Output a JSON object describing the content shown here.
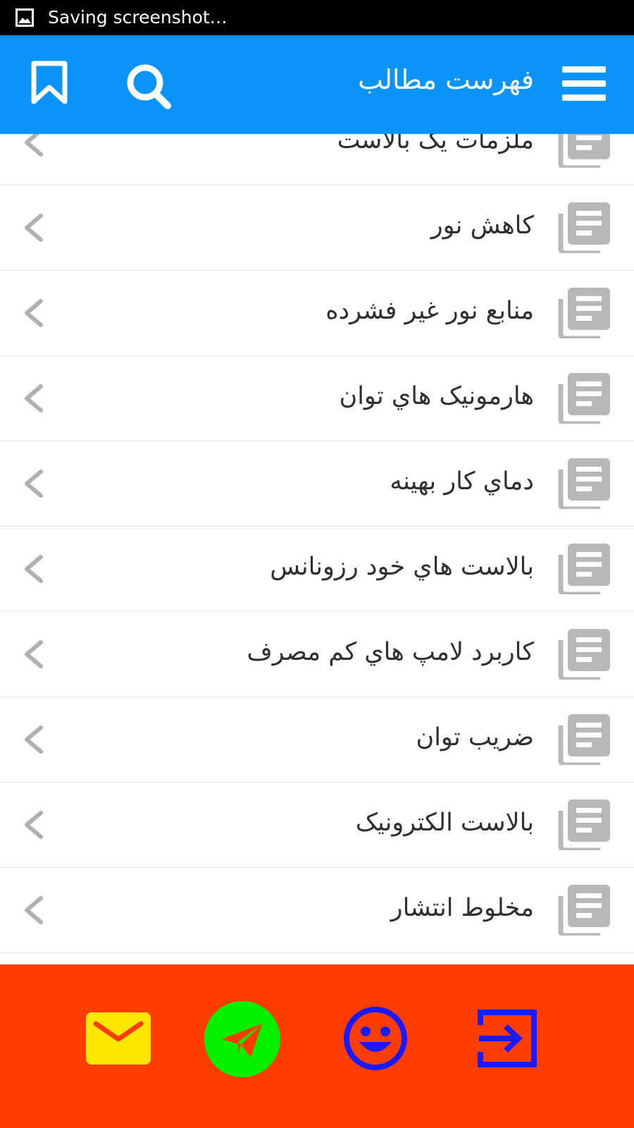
{
  "status_bar": {
    "text": "Saving screenshot…",
    "icon": "image-icon"
  },
  "app_bar": {
    "title": "فهرست مطالب",
    "color": "#0a93f8",
    "icons": [
      "bookmark-icon",
      "search-icon",
      "hamburger-menu-icon"
    ]
  },
  "list": {
    "items": [
      {
        "label": "ملزمات یک بالاست",
        "icon": "document-stack-icon"
      },
      {
        "label": "کاهش نور",
        "icon": "document-stack-icon"
      },
      {
        "label": "منابع نور غیر فشرده",
        "icon": "document-stack-icon"
      },
      {
        "label": "هارمونیک هاي توان",
        "icon": "document-stack-icon"
      },
      {
        "label": "دماي کار بهینه",
        "icon": "document-stack-icon"
      },
      {
        "label": "بالاست هاي خود رزونانس",
        "icon": "document-stack-icon"
      },
      {
        "label": "کاربرد لامپ هاي کم مصرف",
        "icon": "document-stack-icon"
      },
      {
        "label": "ضریب توان",
        "icon": "document-stack-icon"
      },
      {
        "label": "بالاست الکترونیک",
        "icon": "document-stack-icon"
      },
      {
        "label": "مخلوط انتشار",
        "icon": "document-stack-icon"
      }
    ]
  },
  "bottom_bar": {
    "color": "#ff3d00",
    "buttons": [
      {
        "name": "mail-icon",
        "color": "#ffe800"
      },
      {
        "name": "telegram-icon",
        "color": "#00f000"
      },
      {
        "name": "smiley-icon",
        "color": "#1a1aff"
      },
      {
        "name": "login-icon",
        "color": "#1a1aff"
      }
    ]
  }
}
